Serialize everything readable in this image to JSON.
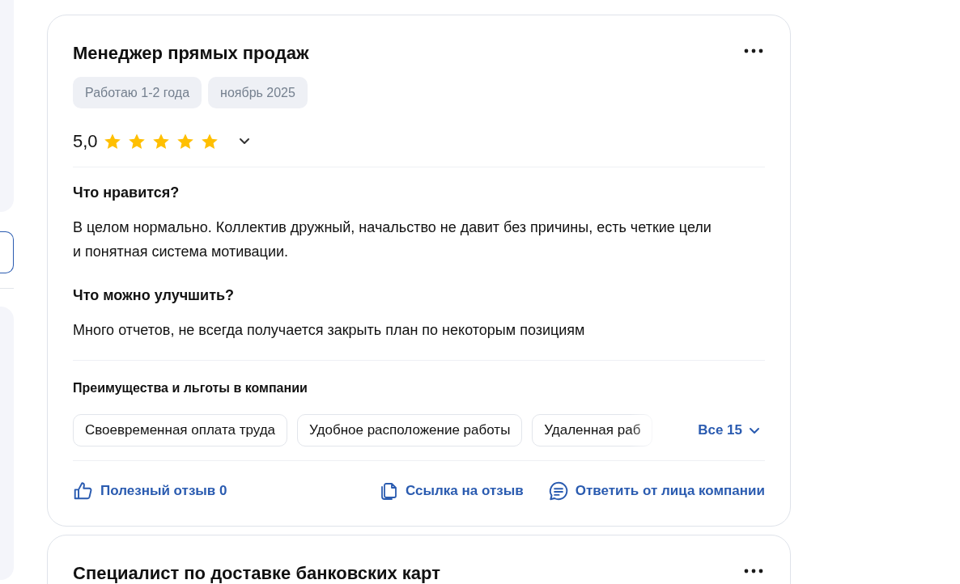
{
  "reviews": [
    {
      "title": "Менеджер прямых продаж",
      "tags": [
        "Работаю 1-2 года",
        "ноябрь 2025"
      ],
      "rating": "5,0",
      "stars": 5,
      "sections": [
        {
          "heading": "Что нравится?",
          "text": "В целом нормально. Коллектив дружный, начальство не давит без причины, есть четкие цели и понятная система мотивации."
        },
        {
          "heading": "Что можно улучшить?",
          "text": "Много отчетов, не всегда получается закрыть план по некоторым позициям"
        }
      ],
      "benefits_title": "Преимущества и льготы в компании",
      "benefits": [
        "Своевременная оплата труда",
        "Удобное расположение работы",
        "Удаленная раб"
      ],
      "benefits_more": "Все 15",
      "actions": [
        {
          "kind": "like",
          "label": "Полезный отзыв 0"
        },
        {
          "kind": "link",
          "label": "Ссылка на отзыв"
        },
        {
          "kind": "reply",
          "label": "Ответить от лица компании"
        }
      ]
    },
    {
      "title": "Специалист по доставке банковских карт"
    }
  ]
}
